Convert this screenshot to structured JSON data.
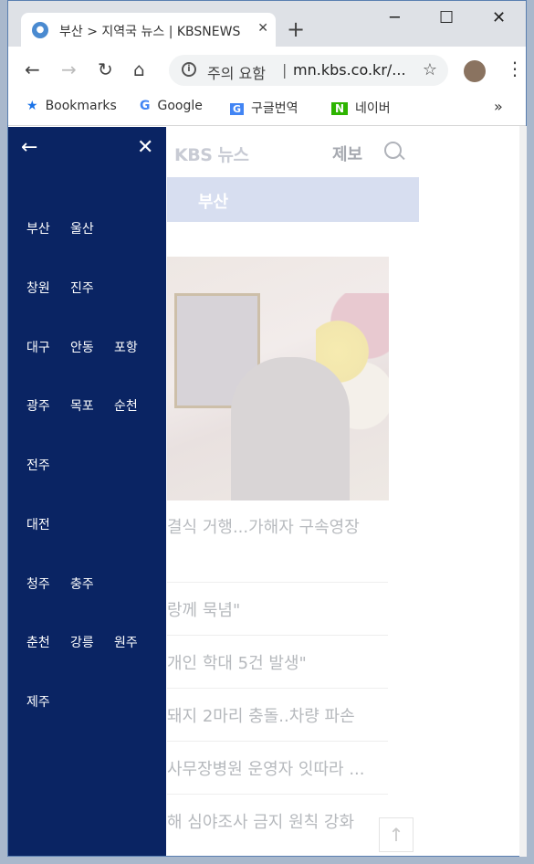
{
  "browser": {
    "tab_title": "부산 > 지역국 뉴스 | KBSNEWS",
    "tab_close": "✕",
    "new_tab": "+",
    "window_controls": {
      "minimize": "─",
      "maximize": "☐",
      "close": "✕"
    },
    "nav": {
      "back": "←",
      "forward": "→",
      "reload": "↻",
      "home": "⌂"
    },
    "security_text": "주의 요함",
    "url": "mn.kbs.co.kr/...",
    "bookmarks": [
      {
        "icon": "★",
        "label": "Bookmarks",
        "color": "#1a73e8"
      },
      {
        "icon": "G",
        "label": "Google",
        "color": "#4285f4"
      },
      {
        "icon": "G",
        "label": "구글번역",
        "color": "#4285f4"
      },
      {
        "icon": "N",
        "label": "네이버",
        "color": "#2db400"
      }
    ],
    "bookmarks_more": "»"
  },
  "page": {
    "logo": "KBS 뉴스",
    "tip": "제보",
    "region_bar": "부산",
    "headline": "결식 거행...가해자 구속영장",
    "news": [
      "랑께 묵념\"",
      "개인 학대 5건 발생\"",
      "돼지 2마리 충돌..차량 파손",
      "사무장병원 운영자 잇따라 ...",
      "해 심야조사 금지 원칙 강화"
    ],
    "top_button": "↑"
  },
  "drawer": {
    "back": "←",
    "close": "✕",
    "rows": [
      [
        "부산",
        "울산"
      ],
      [
        "창원",
        "진주"
      ],
      [
        "대구",
        "안동",
        "포항"
      ],
      [
        "광주",
        "목포",
        "순천"
      ],
      [
        "전주"
      ],
      [
        "대전"
      ],
      [
        "청주",
        "충주"
      ],
      [
        "춘천",
        "강릉",
        "원주"
      ],
      [
        "제주"
      ]
    ]
  }
}
